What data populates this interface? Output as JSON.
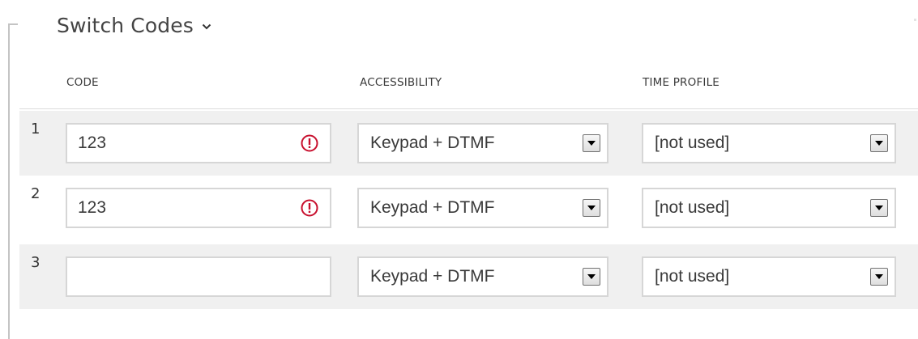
{
  "section": {
    "title": "Switch Codes",
    "expand_icon": "chevron-down-icon"
  },
  "columns": {
    "code": "CODE",
    "accessibility": "ACCESSIBILITY",
    "time_profile": "TIME PROFILE"
  },
  "rows": [
    {
      "number": "1",
      "code": "123",
      "code_warning": true,
      "accessibility": "Keypad + DTMF",
      "time_profile": "[not used]"
    },
    {
      "number": "2",
      "code": "123",
      "code_warning": true,
      "accessibility": "Keypad + DTMF",
      "time_profile": "[not used]"
    },
    {
      "number": "3",
      "code": "",
      "code_warning": false,
      "accessibility": "Keypad + DTMF",
      "time_profile": "[not used]"
    }
  ],
  "colors": {
    "warning": "#c8102e",
    "row_stripe": "#f0f0f0",
    "field_border": "#d6d6d6"
  },
  "icons": {
    "warning": "exclamation-circle-icon",
    "dropdown": "dropdown-arrow-icon"
  }
}
